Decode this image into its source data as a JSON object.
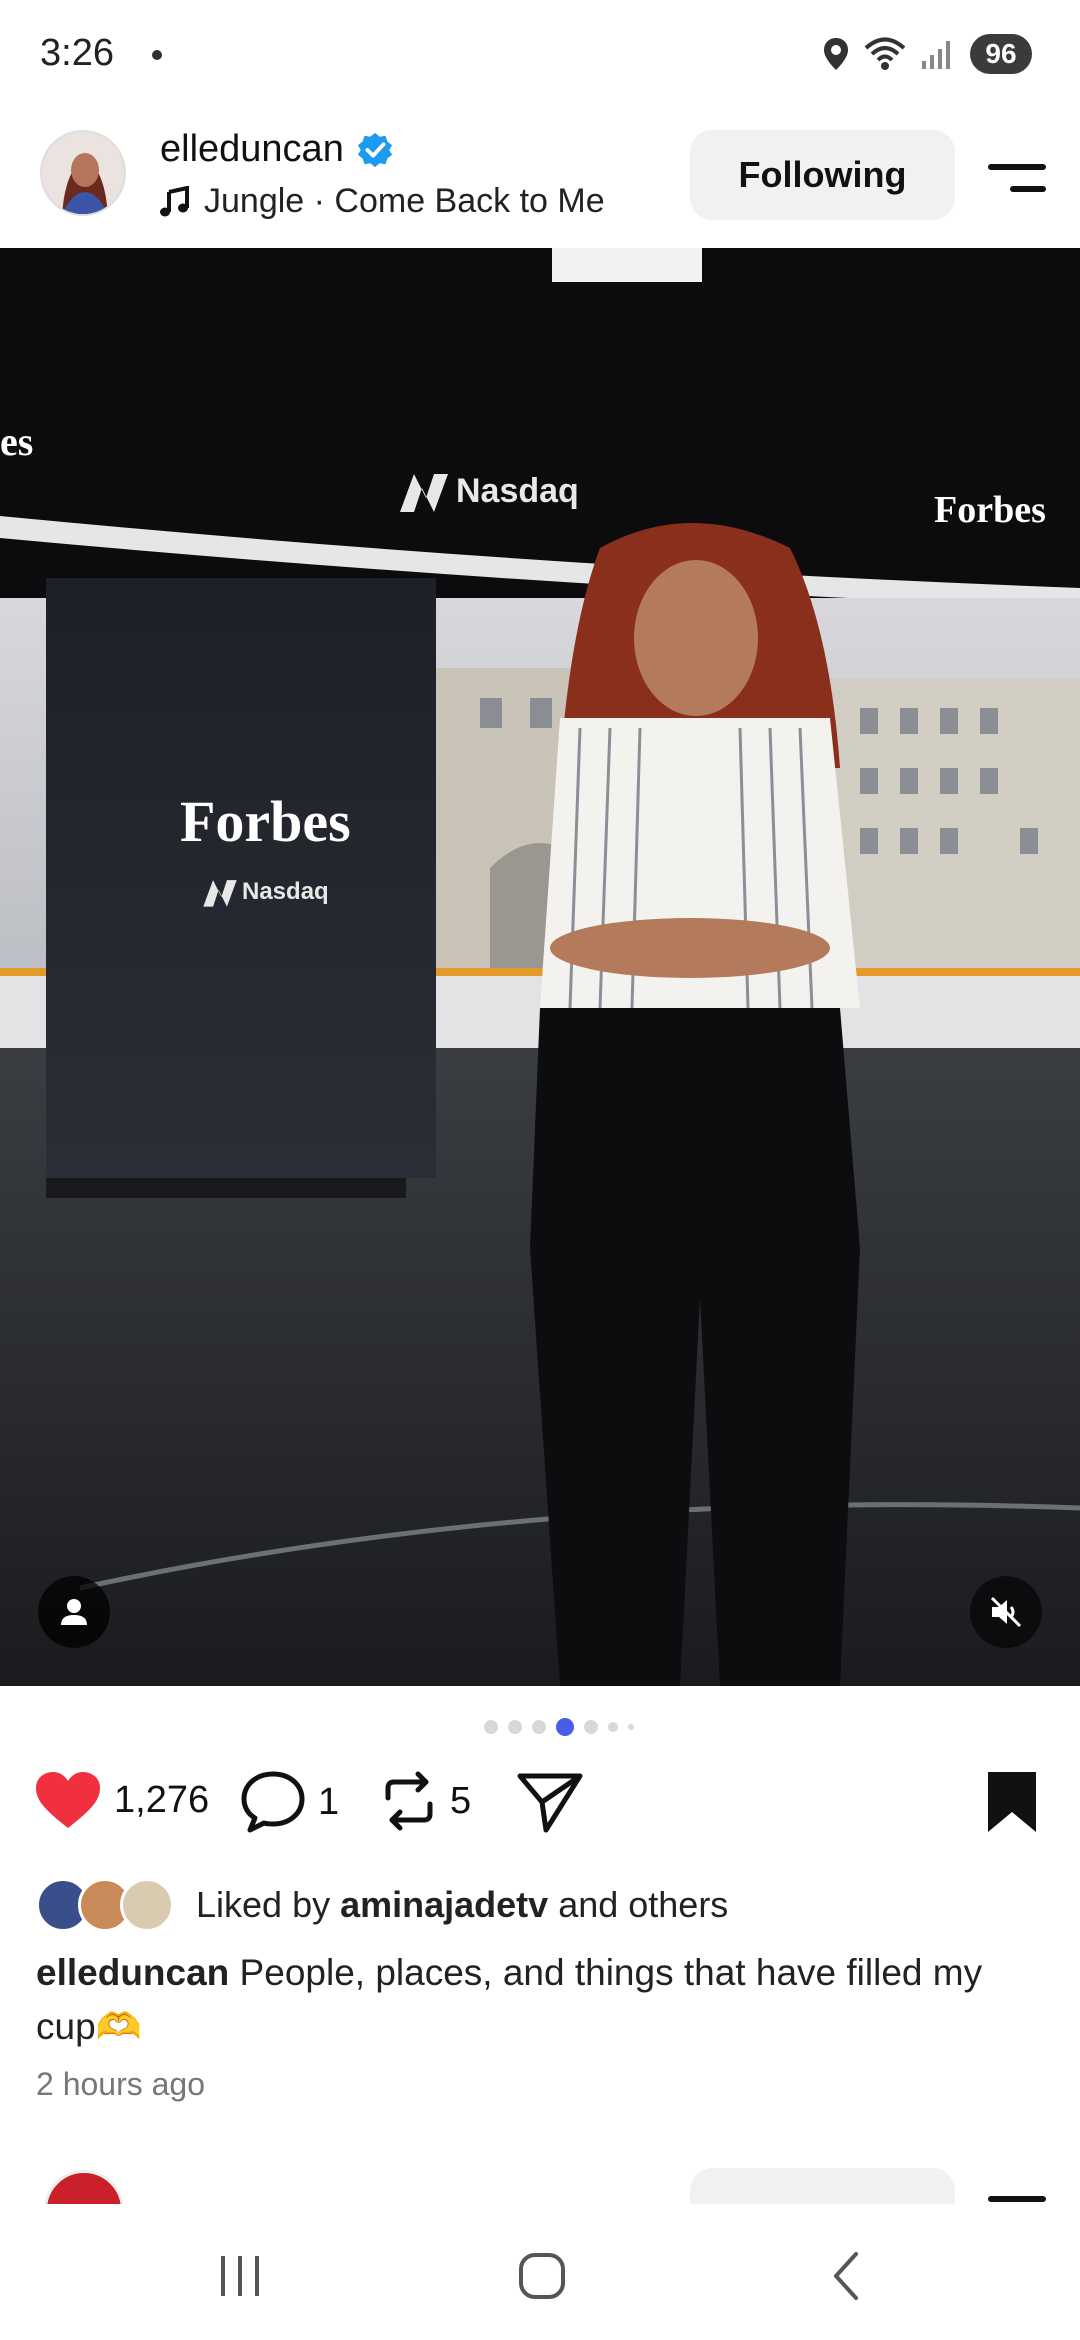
{
  "status_bar": {
    "time": "3:26",
    "battery": "96",
    "icons": [
      "location-icon",
      "wifi-icon",
      "signal-icon"
    ]
  },
  "post": {
    "username": "elleduncan",
    "verified": true,
    "audio": "Jungle · Come Back to Me",
    "follow_button": "Following",
    "photo": {
      "overlay_forbes_left": "es",
      "overlay_nasdaq_top": "Nasdaq",
      "overlay_forbes_right": "Forbes",
      "overlay_forbes_panel": "Forbes",
      "overlay_nasdaq_panel": "Nasdaq"
    },
    "pager": {
      "count": 7,
      "active_index": 3
    },
    "likes_count": "1,276",
    "comments_count": "1",
    "reposts_count": "5",
    "liked": true,
    "saved": true,
    "liked_by_prefix": "Liked by ",
    "liked_by_user": "aminajadetv",
    "liked_by_suffix": " and others",
    "caption_user": "elleduncan",
    "caption_text": " People, places, and things that have filled my cup🫶",
    "timestamp": "2 hours ago"
  },
  "colors": {
    "accent": "#4a5de8",
    "like_red": "#f0303e",
    "verified_blue": "#1d9bf0",
    "button_bg": "#eff1f3"
  },
  "nav_bar": {
    "icons": [
      "recents-icon",
      "home-icon",
      "back-icon"
    ]
  }
}
